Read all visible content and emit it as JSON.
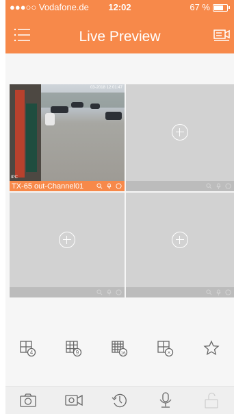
{
  "status_bar": {
    "carrier": "●●●○○ Vodafone.de",
    "time": "12:02",
    "battery": "67 %"
  },
  "header": {
    "title": "Live Preview",
    "menu_icon": "list-menu-icon",
    "device_icon": "device-list-icon"
  },
  "grid": {
    "channel_name": "TX-65 out-Channel01",
    "video_timestamp": "03-2018 12:01:47",
    "video_label": "IPC",
    "add_icon": "plus-circle-icon"
  },
  "split_toolbar": {
    "buttons": [
      {
        "name": "split-4-icon",
        "label": "4"
      },
      {
        "name": "split-9-icon",
        "label": "9"
      },
      {
        "name": "split-16-icon",
        "label": "16"
      },
      {
        "name": "close-all-icon",
        "label": "×"
      },
      {
        "name": "favorite-star-icon",
        "label": ""
      }
    ]
  },
  "tab_bar": {
    "buttons": [
      "snapshot-camera-icon",
      "record-video-icon",
      "playback-icon",
      "microphone-icon",
      "unlock-icon"
    ]
  },
  "colors": {
    "accent": "#f7894a",
    "cell_background": "#d2d2d2",
    "icon_gray": "#666666"
  }
}
